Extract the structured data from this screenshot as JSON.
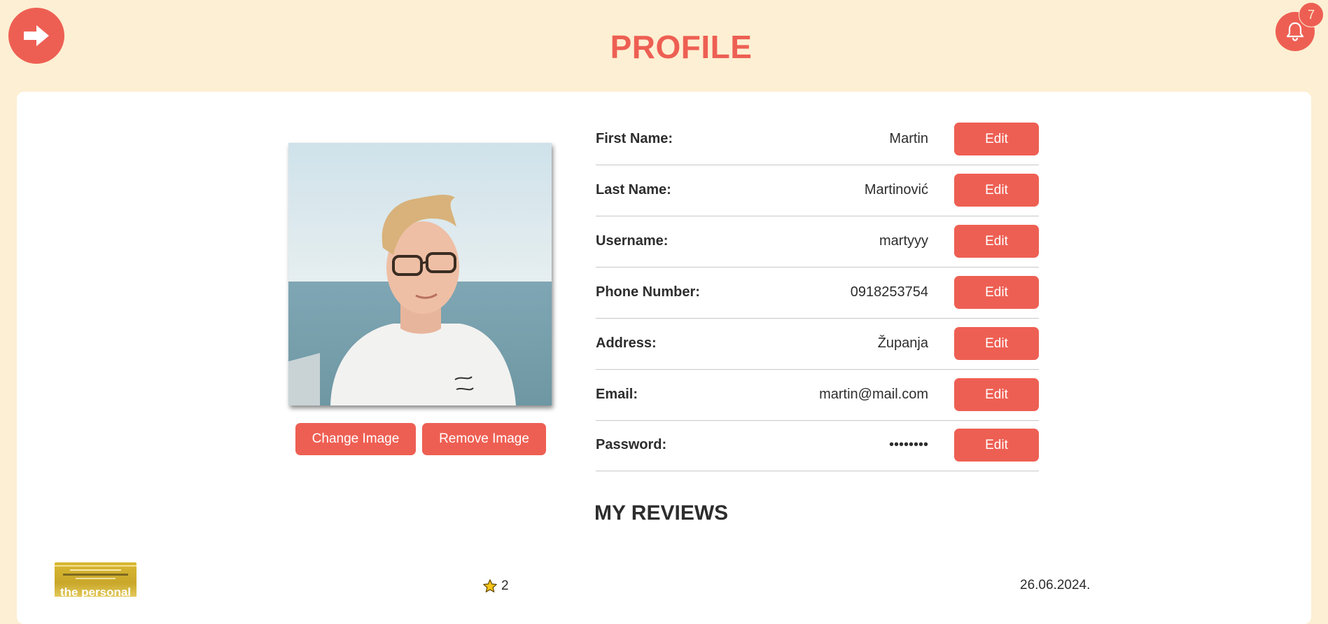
{
  "header": {
    "title": "PROFILE",
    "notification_count": "7"
  },
  "image_actions": {
    "change_label": "Change Image",
    "remove_label": "Remove Image"
  },
  "fields": [
    {
      "label": "First Name:",
      "value": "Martin",
      "edit_label": "Edit"
    },
    {
      "label": "Last Name:",
      "value": "Martinović",
      "edit_label": "Edit"
    },
    {
      "label": "Username:",
      "value": "martyyy",
      "edit_label": "Edit"
    },
    {
      "label": "Phone Number:",
      "value": "0918253754",
      "edit_label": "Edit"
    },
    {
      "label": "Address:",
      "value": "Županja",
      "edit_label": "Edit"
    },
    {
      "label": "Email:",
      "value": "martin@mail.com",
      "edit_label": "Edit"
    },
    {
      "label": "Password:",
      "value": "••••••••",
      "edit_label": "Edit"
    }
  ],
  "reviews": {
    "title": "MY REVIEWS",
    "items": [
      {
        "rating": "2",
        "date": "26.06.2024.",
        "book_cover_text": "the personal"
      }
    ]
  },
  "icons": {
    "back": "arrow-right-icon",
    "notifications": "bell-icon",
    "rating": "star-icon"
  },
  "colors": {
    "background": "#fdefd3",
    "accent": "#ee5f53",
    "card": "#ffffff",
    "text": "#2d2d2d"
  }
}
